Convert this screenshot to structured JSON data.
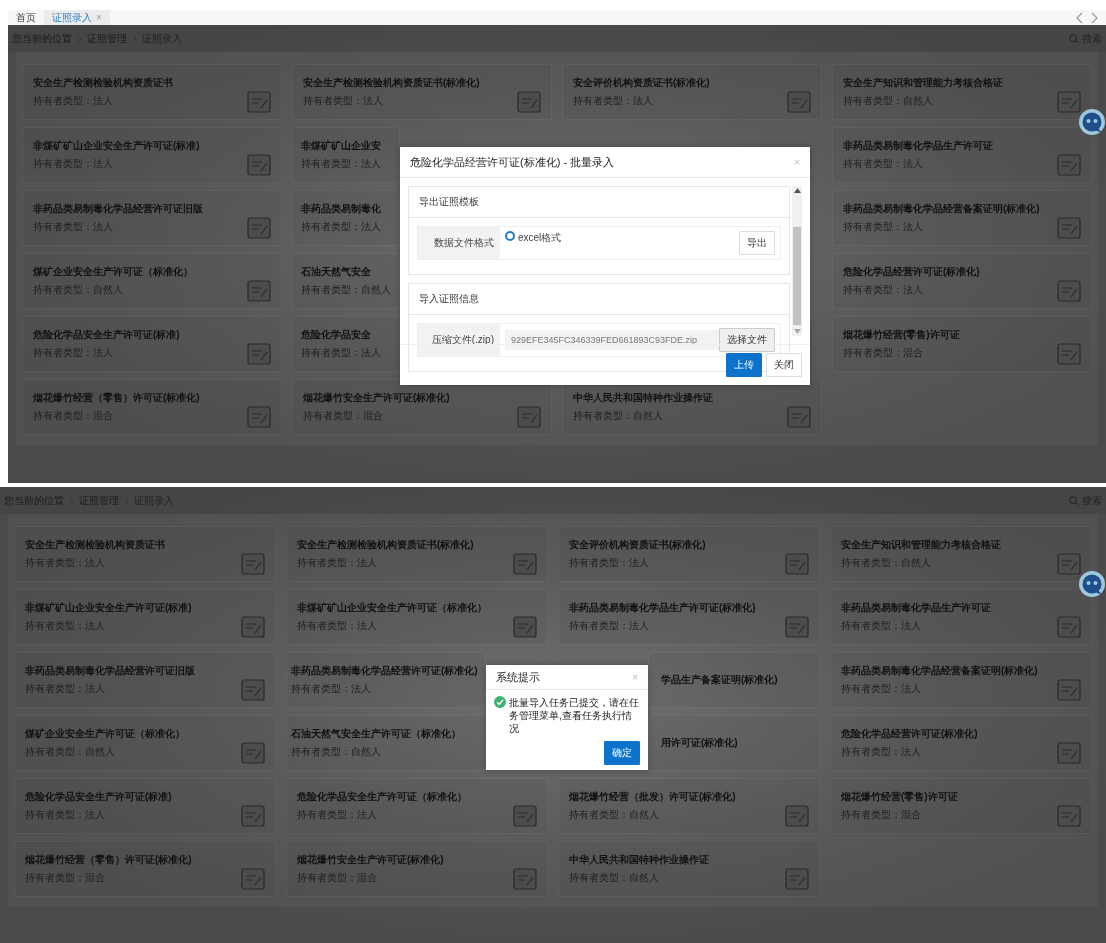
{
  "screens": [
    {
      "tabs": [
        {
          "label": "首页",
          "selected": false
        },
        {
          "label": "证照录入",
          "close": "×",
          "selected": true
        }
      ],
      "breadcrumb": [
        "您当前的位置",
        "证照管理",
        "证照录入"
      ],
      "search_label": "搜索",
      "cards": [
        {
          "kind": "full",
          "title": "安全生产检测检验机构资质证书",
          "holder": "持有者类型：法人"
        },
        {
          "kind": "full",
          "title": "安全生产检测检验机构资质证书(标准化)",
          "holder": "持有者类型：法人"
        },
        {
          "kind": "full",
          "title": "安全评价机构资质证书(标准化)",
          "holder": "持有者类型：法人"
        },
        {
          "kind": "full",
          "title": "安全生产知识和管理能力考核合格证",
          "holder": "持有者类型：自然人"
        },
        {
          "kind": "full",
          "title": "非煤矿矿山企业安全生产许可证(标准)",
          "holder": "持有者类型：法人"
        },
        {
          "kind": "cut",
          "title": "非煤矿矿山企业安",
          "holder": "持有者类型：法人"
        },
        {
          "kind": "hidden"
        },
        {
          "kind": "full",
          "title": "非药品类易制毒化学品生产许可证",
          "holder": "持有者类型：法人"
        },
        {
          "kind": "full",
          "title": "非药品类易制毒化学品经营许可证旧版",
          "holder": "持有者类型：法人"
        },
        {
          "kind": "cut",
          "title": "非药品类易制毒化",
          "holder": "持有者类型：法人"
        },
        {
          "kind": "hidden"
        },
        {
          "kind": "full",
          "title": "非药品类易制毒化学品经营备案证明(标准化)",
          "holder": "持有者类型：法人"
        },
        {
          "kind": "full",
          "title": "煤矿企业安全生产许可证（标准化）",
          "holder": "持有者类型：自然人"
        },
        {
          "kind": "cut",
          "title": "石油天然气安全",
          "holder": "持有者类型：自然人"
        },
        {
          "kind": "hidden"
        },
        {
          "kind": "full",
          "title": "危险化学品经营许可证(标准化)",
          "holder": "持有者类型：法人"
        },
        {
          "kind": "full",
          "title": "危险化学品安全生产许可证(标准)",
          "holder": "持有者类型：法人"
        },
        {
          "kind": "cut",
          "title": "危险化学品安全",
          "holder": "持有者类型：法人"
        },
        {
          "kind": "hidden"
        },
        {
          "kind": "full",
          "title": "烟花爆竹经营(零售)许可证",
          "holder": "持有者类型：混合"
        },
        {
          "kind": "full",
          "title": "烟花爆竹经营（零售）许可证(标准化)",
          "holder": "持有者类型：混合"
        },
        {
          "kind": "full",
          "title": "烟花爆竹安全生产许可证(标准化)",
          "holder": "持有者类型：混合"
        },
        {
          "kind": "full",
          "title": "中华人民共和国特种作业操作证",
          "holder": "持有者类型：自然人"
        }
      ],
      "dialog": {
        "kind": "batch_import",
        "title": "危险化学品经营许可证(标准化) - 批量录入",
        "close": "×",
        "sections": [
          {
            "kind": "export",
            "heading": "导出证照模板",
            "label": "数据文件格式",
            "option": {
              "label": "excel格式",
              "selected": true
            },
            "button": "导出"
          },
          {
            "kind": "import",
            "heading": "导入证照信息",
            "label": "压缩文件(.zip)",
            "value": "929EFE345FC346339FED661893C93FDE.zip",
            "button": "选择文件"
          }
        ],
        "buttons": [
          {
            "label": "上传",
            "primary": true
          },
          {
            "label": "关闭",
            "primary": false
          }
        ]
      }
    },
    {
      "breadcrumb": [
        "您当前的位置",
        "证照管理",
        "证照录入"
      ],
      "search_label": "搜索",
      "cards": [
        {
          "kind": "full",
          "title": "安全生产检测检验机构资质证书",
          "holder": "持有者类型：法人"
        },
        {
          "kind": "full",
          "title": "安全生产检测检验机构资质证书(标准化)",
          "holder": "持有者类型：法人"
        },
        {
          "kind": "full",
          "title": "安全评价机构资质证书(标准化)",
          "holder": "持有者类型：法人"
        },
        {
          "kind": "full",
          "title": "安全生产知识和管理能力考核合格证",
          "holder": "持有者类型：自然人"
        },
        {
          "kind": "full",
          "title": "非煤矿矿山企业安全生产许可证(标准)",
          "holder": "持有者类型：法人"
        },
        {
          "kind": "full",
          "title": "非煤矿矿山企业安全生产许可证（标准化）",
          "holder": "持有者类型：法人"
        },
        {
          "kind": "full",
          "title": "非药品类易制毒化学品生产许可证(标准化)",
          "holder": "持有者类型：法人"
        },
        {
          "kind": "full",
          "title": "非药品类易制毒化学品生产许可证",
          "holder": "持有者类型：法人"
        },
        {
          "kind": "full",
          "title": "非药品类易制毒化学品经营许可证旧版",
          "holder": "持有者类型：法人"
        },
        {
          "kind": "cut",
          "title": "非药品类易制毒化学品经营许可证(标准化)",
          "holder": "持有者类型：法人"
        },
        {
          "kind": "tail",
          "title": "学品生产备案证明(标准化)"
        },
        {
          "kind": "full",
          "title": "非药品类易制毒化学品经营备案证明(标准化)",
          "holder": "持有者类型：法人"
        },
        {
          "kind": "full",
          "title": "煤矿企业安全生产许可证（标准化）",
          "holder": "持有者类型：自然人"
        },
        {
          "kind": "cut",
          "title": "石油天然气安全生产许可证（标准化）",
          "holder": "持有者类型：自然人"
        },
        {
          "kind": "tail",
          "title": "用许可证(标准化)"
        },
        {
          "kind": "full",
          "title": "危险化学品经营许可证(标准化)",
          "holder": "持有者类型：法人"
        },
        {
          "kind": "full",
          "title": "危险化学品安全生产许可证(标准)",
          "holder": "持有者类型：法人"
        },
        {
          "kind": "full",
          "title": "危险化学品安全生产许可证（标准化）",
          "holder": "持有者类型：法人"
        },
        {
          "kind": "full",
          "title": "烟花爆竹经营（批发）许可证(标准化)",
          "holder": "持有者类型：自然人"
        },
        {
          "kind": "full",
          "title": "烟花爆竹经营(零售)许可证",
          "holder": "持有者类型：混合"
        },
        {
          "kind": "full",
          "title": "烟花爆竹经营（零售）许可证(标准化)",
          "holder": "持有者类型：混合"
        },
        {
          "kind": "full",
          "title": "烟花爆竹安全生产许可证(标准化)",
          "holder": "持有者类型：混合"
        },
        {
          "kind": "full",
          "title": "中华人民共和国特种作业操作证",
          "holder": "持有者类型：自然人"
        }
      ],
      "dialog": {
        "kind": "alert",
        "title": "系统提示",
        "close": "×",
        "message": "批量导入任务已提交，请在任务管理菜单,查看任务执行情况",
        "buttons": [
          {
            "label": "确定",
            "primary": true
          }
        ]
      }
    }
  ]
}
